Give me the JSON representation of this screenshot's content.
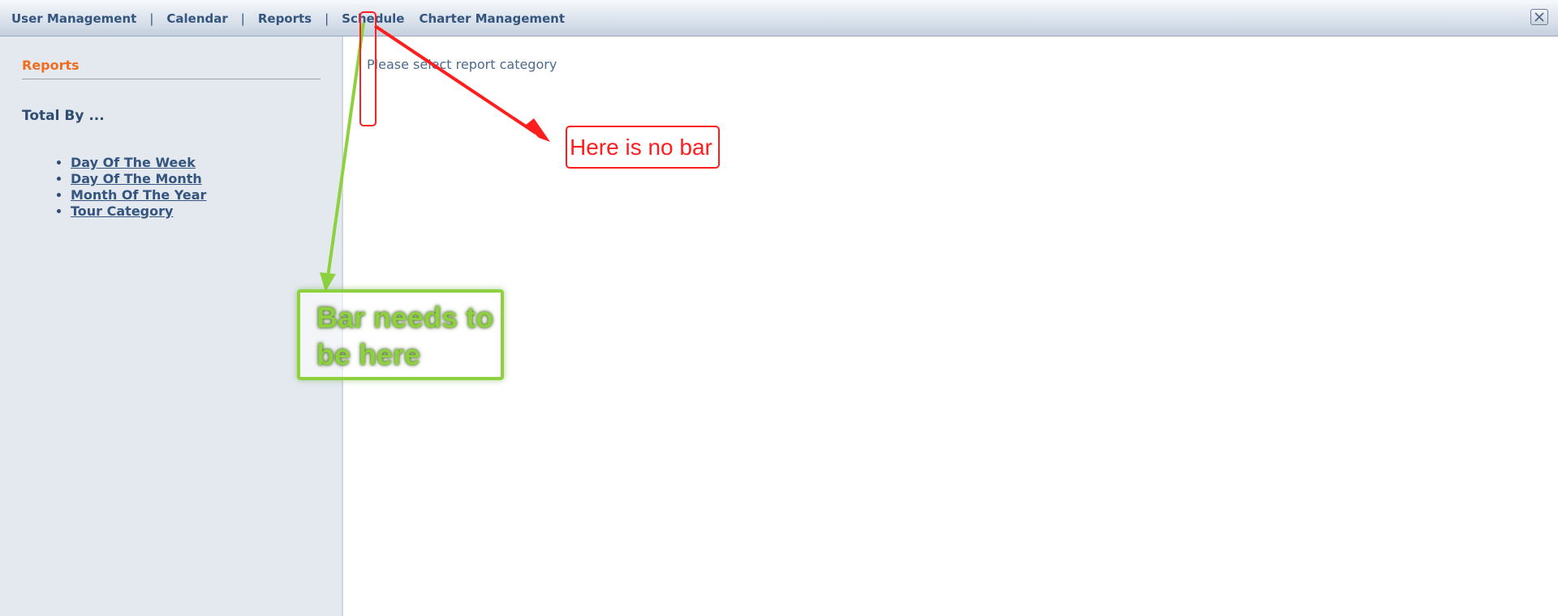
{
  "nav": {
    "items": [
      {
        "label": "User Management"
      },
      {
        "label": "Calendar"
      },
      {
        "label": "Reports"
      },
      {
        "label": "Schedule"
      },
      {
        "label": "Charter Management"
      }
    ],
    "separator": "|"
  },
  "window": {
    "close_icon": "close-icon"
  },
  "sidebar": {
    "title": "Reports",
    "heading": "Total By ...",
    "items": [
      {
        "label": "Day Of The Week"
      },
      {
        "label": "Day Of The Month"
      },
      {
        "label": "Month Of The Year"
      },
      {
        "label": "Tour Category"
      }
    ]
  },
  "main": {
    "message": "Please select report category"
  },
  "annotations": {
    "red_note": "Here is no bar",
    "green_note": "Bar needs to be here",
    "colors": {
      "red": "#ff1e1e",
      "green": "#8ed13f"
    }
  }
}
